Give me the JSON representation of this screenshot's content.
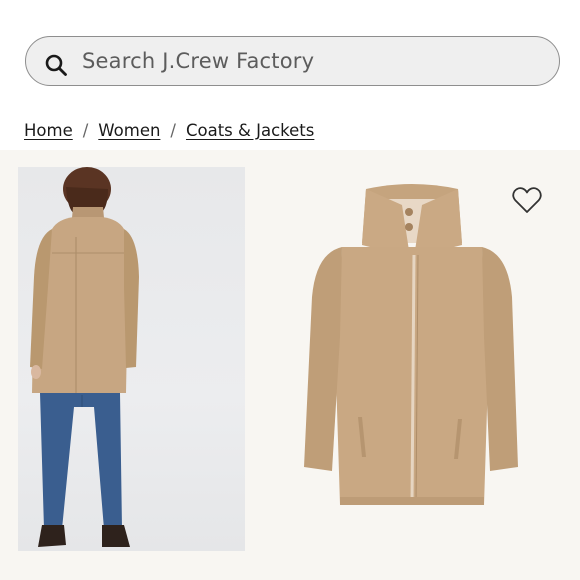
{
  "search": {
    "placeholder": "Search J.Crew Factory"
  },
  "breadcrumb": {
    "items": [
      {
        "label": "Home"
      },
      {
        "label": "Women"
      },
      {
        "label": "Coats & Jackets"
      }
    ],
    "separator": "/"
  },
  "colors": {
    "coat": "#c9a883",
    "gallery_bg": "#f8f6f2",
    "jeans": "#3a5e8f"
  },
  "icons": {
    "search": "search-icon",
    "favorite": "heart-icon"
  }
}
